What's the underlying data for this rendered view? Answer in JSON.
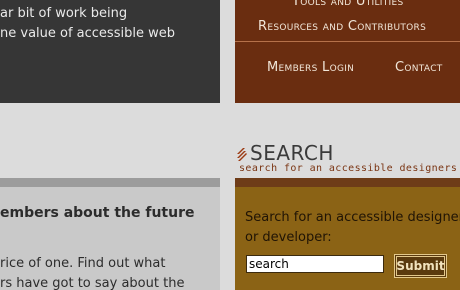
{
  "left_intro": {
    "line1": "ar bit of work being",
    "line2": "ne value of accessible web"
  },
  "nav": {
    "tools": "Tools and Utilities",
    "resources": "Resources and Contributors",
    "members_login": "Members Login",
    "contact": "Contact"
  },
  "members": {
    "heading": "embers about the future",
    "line1": "rice of one. Find out what",
    "line2": "rs have got to say about the"
  },
  "search": {
    "title": "SEARCH",
    "subtitle": "search for an accessible designers",
    "label_line1": "Search for an accessible designer",
    "label_line2": "or developer:",
    "input_value": "search",
    "submit_label": "Submit"
  },
  "colors": {
    "nav_brown": "#6a2d10",
    "search_panel_gold": "#8b6315",
    "dark_panel": "#363636"
  }
}
